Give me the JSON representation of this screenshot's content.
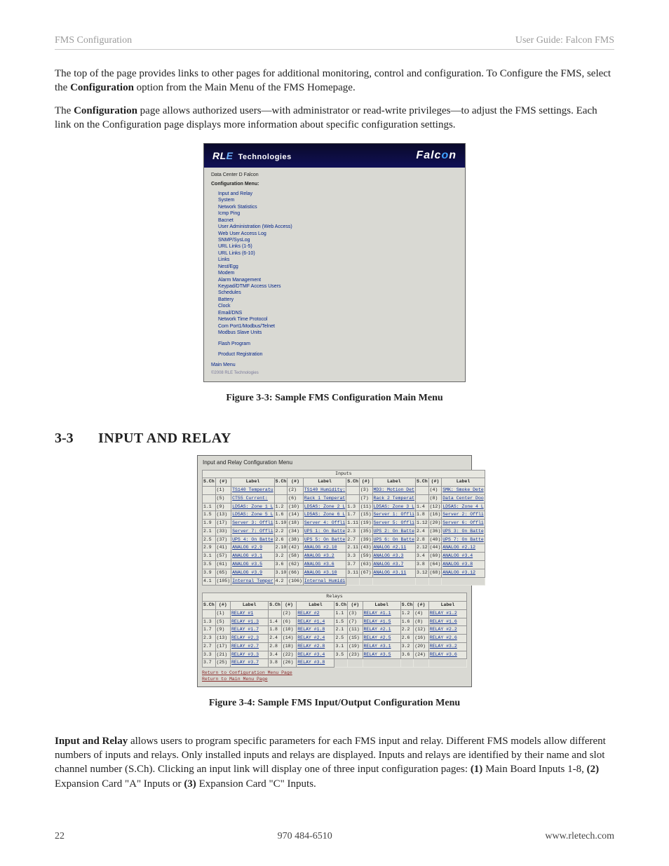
{
  "runhead": {
    "left": "FMS Configuration",
    "right": "User Guide: Falcon FMS"
  },
  "body": {
    "p1": "The top of the page provides links to other pages for additional monitoring, control and configuration. To Configure the FMS, select the ",
    "p1b": "Configuration",
    "p1c": " option from the Main Menu of the FMS Homepage.",
    "p2a": " The ",
    "p2b": "Configuration",
    "p2c": " page allows authorized users—with administrator or read-write privileges—to adjust the FMS settings. Each link on the Configuration page displays more information about specific configuration settings.",
    "cap1": "Figure 3-3: Sample FMS Configuration Main Menu",
    "secnum": "3-3",
    "sectitle": "INPUT AND RELAY",
    "cap2": "Figure 3-4: Sample FMS Input/Output Configuration Menu",
    "p3a": "Input and Relay",
    "p3b": " allows users to program specific parameters for each FMS input and relay. Different FMS models allow different numbers of inputs and relays. Only installed inputs and relays are displayed.  Inputs and relays are identified by their name and slot channel number (S.Ch). Clicking an input link will display one of three input configuration pages: ",
    "p3c": "(1)",
    "p3d": " Main Board Inputs 1-8, ",
    "p3e": "(2)",
    "p3f": " Expansion Card \"A\" Inputs or ",
    "p3g": "(3)",
    "p3h": " Expansion Card \"C\" Inputs."
  },
  "shot1": {
    "banner_left_a": "RL",
    "banner_left_b": "E",
    "banner_left_c": "Technologies",
    "banner_right": "Falc",
    "banner_right_o": "o",
    "banner_right_n": "n",
    "title1": "Data Center D Falcon",
    "title2": "Configuration Menu:",
    "menu": [
      "Input and Relay",
      "System",
      "Network Statistics",
      "Icmp Ping",
      "Bacnet",
      "User Administration (Web Access)",
      "Web User Access Log",
      "SNMP/SysLog",
      "URL Links (1-5)",
      "URL Links (6-10)",
      "Links",
      "Nest/Egg",
      "Modem",
      "Alarm Management",
      "Keypad/DTMF Access Users",
      "Schedules",
      "Battery",
      "Clock",
      "Email/DNS",
      "Network Time Protocol",
      "Com Port1/Modbus/Telnet",
      "Modbus Slave Units"
    ],
    "flash": "Flash Program",
    "reg": "Product Registration",
    "main": "Main Menu",
    "copy": "©2008 RLE Technologies"
  },
  "shot2": {
    "mtitle": "Input and Relay Configuration Menu",
    "cap_inputs": "Inputs",
    "cap_relays": "Relays",
    "hdr": {
      "sch": "S.Ch",
      "num": "(#)",
      "label": "Label"
    },
    "inputs": [
      [
        {
          "s": "",
          "n": "(1)",
          "l": "TS140 Temperatu"
        },
        {
          "s": "",
          "n": "(2)",
          "l": "TS140 Humidity:"
        },
        {
          "s": "",
          "n": "(3)",
          "l": "MD3: Motion Det"
        },
        {
          "s": "",
          "n": "(4)",
          "l": "SMK: Smoke Dete"
        }
      ],
      [
        {
          "s": "",
          "n": "(5)",
          "l": "CT55 Current:"
        },
        {
          "s": "",
          "n": "(6)",
          "l": "Rack 1 Temperat"
        },
        {
          "s": "",
          "n": "(7)",
          "l": "Rack 2 Temperat"
        },
        {
          "s": "",
          "n": "(8)",
          "l": "Data Center Doo"
        }
      ],
      [
        {
          "s": "1.1",
          "n": "(9)",
          "l": "LD5AS: Zone 1 L"
        },
        {
          "s": "1.2",
          "n": "(10)",
          "l": "LD5AS: Zone 2 L"
        },
        {
          "s": "1.3",
          "n": "(11)",
          "l": "LD5AS: Zone 3 L"
        },
        {
          "s": "1.4",
          "n": "(12)",
          "l": "LD5AS: Zone 4 L"
        }
      ],
      [
        {
          "s": "1.5",
          "n": "(13)",
          "l": "LD5AS: Zone 5 L"
        },
        {
          "s": "1.6",
          "n": "(14)",
          "l": "LD5AS: Zone 6 L"
        },
        {
          "s": "1.7",
          "n": "(15)",
          "l": "Server 1: Offli"
        },
        {
          "s": "1.8",
          "n": "(16)",
          "l": "Server 2: Offli"
        }
      ],
      [
        {
          "s": "1.9",
          "n": "(17)",
          "l": "Server 3: Offli"
        },
        {
          "s": "1.10",
          "n": "(18)",
          "l": "Server 4: Offli"
        },
        {
          "s": "1.11",
          "n": "(19)",
          "l": "Server 5: Offli"
        },
        {
          "s": "1.12",
          "n": "(20)",
          "l": "Server 6: Offli"
        }
      ],
      [
        {
          "s": "2.1",
          "n": "(33)",
          "l": "Server 7: Offli"
        },
        {
          "s": "2.2",
          "n": "(34)",
          "l": "UPS 1: On Batte"
        },
        {
          "s": "2.3",
          "n": "(35)",
          "l": "UPS 2: On Batte"
        },
        {
          "s": "2.4",
          "n": "(36)",
          "l": "UPS 3: On Batte"
        }
      ],
      [
        {
          "s": "2.5",
          "n": "(37)",
          "l": "UPS 4: On Batte"
        },
        {
          "s": "2.6",
          "n": "(38)",
          "l": "UPS 5: On Batte"
        },
        {
          "s": "2.7",
          "n": "(39)",
          "l": "UPS 6: On Batte"
        },
        {
          "s": "2.8",
          "n": "(40)",
          "l": "UPS 7: On Batte"
        }
      ],
      [
        {
          "s": "2.9",
          "n": "(41)",
          "l": "ANALOG #2.9"
        },
        {
          "s": "2.10",
          "n": "(42)",
          "l": "ANALOG #2.10"
        },
        {
          "s": "2.11",
          "n": "(43)",
          "l": "ANALOG #2.11"
        },
        {
          "s": "2.12",
          "n": "(44)",
          "l": "ANALOG #2.12"
        }
      ],
      [
        {
          "s": "3.1",
          "n": "(57)",
          "l": "ANALOG #3.1"
        },
        {
          "s": "3.2",
          "n": "(58)",
          "l": "ANALOG #3.2"
        },
        {
          "s": "3.3",
          "n": "(59)",
          "l": "ANALOG #3.3"
        },
        {
          "s": "3.4",
          "n": "(60)",
          "l": "ANALOG #3.4"
        }
      ],
      [
        {
          "s": "3.5",
          "n": "(61)",
          "l": "ANALOG #3.5"
        },
        {
          "s": "3.6",
          "n": "(62)",
          "l": "ANALOG #3.6"
        },
        {
          "s": "3.7",
          "n": "(63)",
          "l": "ANALOG #3.7"
        },
        {
          "s": "3.8",
          "n": "(64)",
          "l": "ANALOG #3.8"
        }
      ],
      [
        {
          "s": "3.9",
          "n": "(65)",
          "l": "ANALOG #3.9"
        },
        {
          "s": "3.10",
          "n": "(66)",
          "l": "ANALOG #3.10"
        },
        {
          "s": "3.11",
          "n": "(67)",
          "l": "ANALOG #3.11"
        },
        {
          "s": "3.12",
          "n": "(68)",
          "l": "ANALOG #3.12"
        }
      ],
      [
        {
          "s": "4.1",
          "n": "(105)",
          "l": "Internal Temper"
        },
        {
          "s": "4.2",
          "n": "(106)",
          "l": "Internal Humidi"
        },
        {
          "s": "",
          "n": "",
          "l": "",
          "empty": true
        },
        {
          "s": "",
          "n": "",
          "l": "",
          "empty": true
        }
      ]
    ],
    "relays": [
      [
        {
          "s": "",
          "n": "(1)",
          "l": "RELAY #1"
        },
        {
          "s": "",
          "n": "(2)",
          "l": "RELAY #2"
        },
        {
          "s": "1.1",
          "n": "(3)",
          "l": "RELAY #1.1"
        },
        {
          "s": "1.2",
          "n": "(4)",
          "l": "RELAY #1.2"
        }
      ],
      [
        {
          "s": "1.3",
          "n": "(5)",
          "l": "RELAY #1.3"
        },
        {
          "s": "1.4",
          "n": "(6)",
          "l": "RELAY #1.4"
        },
        {
          "s": "1.5",
          "n": "(7)",
          "l": "RELAY #1.5"
        },
        {
          "s": "1.6",
          "n": "(8)",
          "l": "RELAY #1.6"
        }
      ],
      [
        {
          "s": "1.7",
          "n": "(9)",
          "l": "RELAY #1.7"
        },
        {
          "s": "1.8",
          "n": "(10)",
          "l": "RELAY #1.8"
        },
        {
          "s": "2.1",
          "n": "(11)",
          "l": "RELAY #2.1"
        },
        {
          "s": "2.2",
          "n": "(12)",
          "l": "RELAY #2.2"
        }
      ],
      [
        {
          "s": "2.3",
          "n": "(13)",
          "l": "RELAY #2.3"
        },
        {
          "s": "2.4",
          "n": "(14)",
          "l": "RELAY #2.4"
        },
        {
          "s": "2.5",
          "n": "(15)",
          "l": "RELAY #2.5"
        },
        {
          "s": "2.6",
          "n": "(16)",
          "l": "RELAY #2.6"
        }
      ],
      [
        {
          "s": "2.7",
          "n": "(17)",
          "l": "RELAY #2.7"
        },
        {
          "s": "2.8",
          "n": "(18)",
          "l": "RELAY #2.8"
        },
        {
          "s": "3.1",
          "n": "(19)",
          "l": "RELAY #3.1"
        },
        {
          "s": "3.2",
          "n": "(20)",
          "l": "RELAY #3.2"
        }
      ],
      [
        {
          "s": "3.3",
          "n": "(21)",
          "l": "RELAY #3.3"
        },
        {
          "s": "3.4",
          "n": "(22)",
          "l": "RELAY #3.4"
        },
        {
          "s": "3.5",
          "n": "(23)",
          "l": "RELAY #3.5"
        },
        {
          "s": "3.6",
          "n": "(24)",
          "l": "RELAY #3.6"
        }
      ],
      [
        {
          "s": "3.7",
          "n": "(25)",
          "l": "RELAY #3.7"
        },
        {
          "s": "3.8",
          "n": "(26)",
          "l": "RELAY #3.8"
        },
        {
          "s": "",
          "n": "",
          "l": "",
          "empty": true
        },
        {
          "s": "",
          "n": "",
          "l": "",
          "empty": true
        }
      ]
    ],
    "ret1": "Return to Configuration Menu Page",
    "ret2": "Return to Main Menu Page"
  },
  "foot": {
    "left": "22",
    "center": "970 484-6510",
    "right": "www.rletech.com"
  }
}
